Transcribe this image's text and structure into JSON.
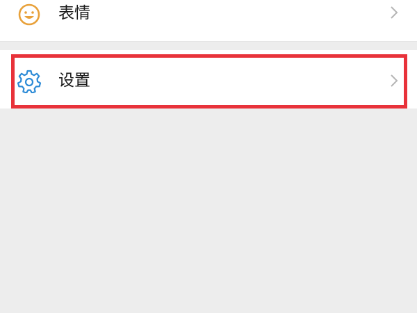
{
  "menu": {
    "items": [
      {
        "label": "表情",
        "icon": "smile-icon",
        "icon_color": "#e8a13a"
      },
      {
        "label": "设置",
        "icon": "gear-icon",
        "icon_color": "#2b8ad6"
      }
    ]
  },
  "highlight": {
    "color": "#e8323a",
    "target": "设置"
  },
  "colors": {
    "background": "#ededed",
    "row": "#ffffff",
    "chevron": "#b5b5b5"
  }
}
